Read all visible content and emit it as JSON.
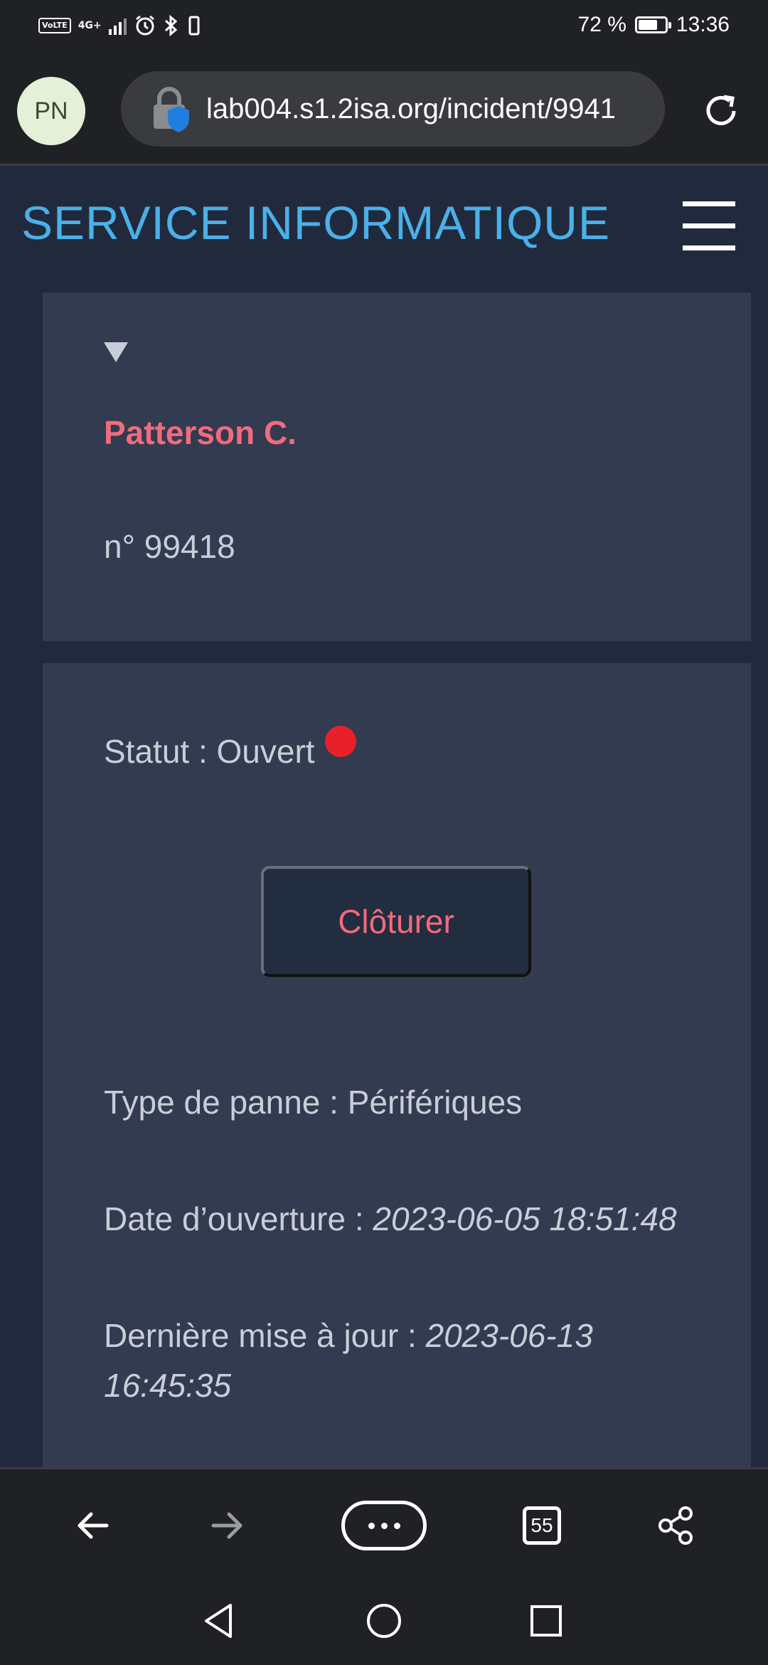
{
  "status_bar": {
    "volte": "VoLTE",
    "network": "4G+",
    "battery_text": "72 %",
    "battery_level": 0.72,
    "time": "13:36"
  },
  "browser": {
    "avatar_initials": "PN",
    "url": "lab004.s1.2isa.org/incident/9941",
    "tab_count": "55"
  },
  "site": {
    "title": "SERVICE INFORMATIQUE"
  },
  "incident": {
    "name": "Patterson C.",
    "number": "n° 99418",
    "status_label": "Statut : Ouvert",
    "close_button": "Clôturer",
    "type_label": "Type de panne : Périfériques",
    "opened_label": "Date d’ouverture : ",
    "opened_value": "2023-06-05 18:51:48",
    "updated_label": "Dernière mise à jour : ",
    "updated_value": "2023-06-13 16:45:35"
  },
  "colors": {
    "accent_title": "#4bb0e8",
    "name_pink": "#f26b7c",
    "status_red": "#e8202a",
    "card_bg": "#323b50",
    "page_bg": "#212a3c"
  },
  "icons": [
    "lock-icon",
    "shield-icon",
    "reload-icon",
    "hamburger-icon",
    "back-arrow-icon",
    "forward-arrow-icon",
    "more-icon",
    "tabs-icon",
    "share-icon",
    "nav-back-icon",
    "nav-home-icon",
    "nav-recents-icon",
    "alarm-icon",
    "bluetooth-icon",
    "vibrate-icon",
    "battery-icon",
    "signal-icon"
  ]
}
